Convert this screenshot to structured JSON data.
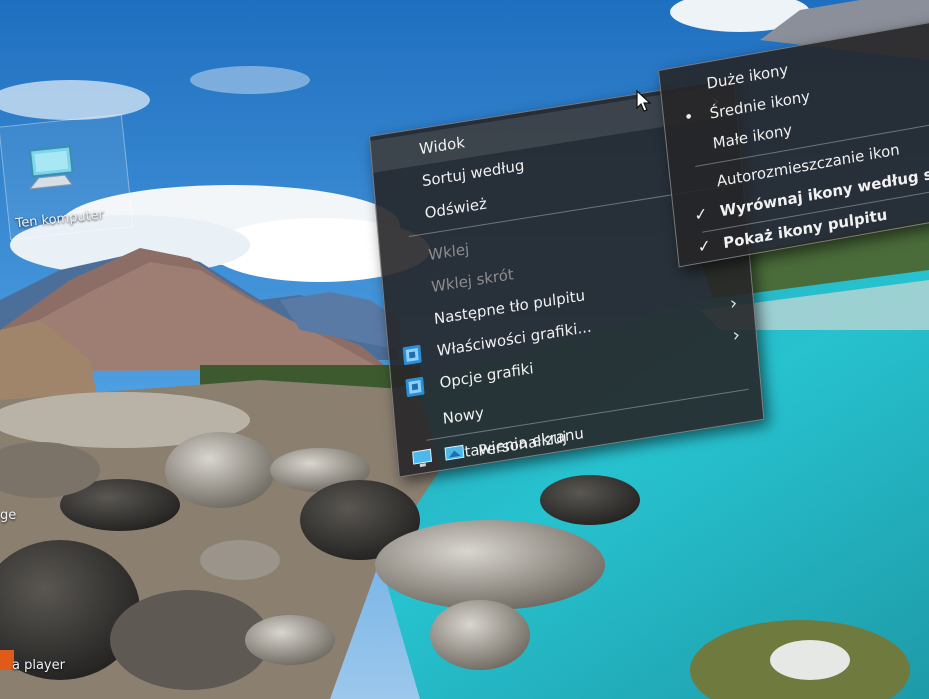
{
  "desktop": {
    "this_pc_label": "Ten komputer",
    "media_player_label": "a player",
    "edge_fragment_label": "ge"
  },
  "context_menu": {
    "items": [
      {
        "label": "Widok",
        "submenu": true,
        "enabled": true
      },
      {
        "label": "Sortuj według",
        "submenu": false,
        "enabled": true
      },
      {
        "label": "Odśwież",
        "submenu": false,
        "enabled": true
      },
      {
        "label": "Wklej",
        "submenu": false,
        "enabled": false
      },
      {
        "label": "Wklej skrót",
        "submenu": false,
        "enabled": false
      },
      {
        "label": "Następne tło pulpitu",
        "submenu": false,
        "enabled": true
      },
      {
        "label": "Właściwości grafiki...",
        "submenu": true,
        "enabled": true,
        "icon": "graphics-icon"
      },
      {
        "label": "Opcje grafiki",
        "submenu": true,
        "enabled": true,
        "icon": "graphics-icon"
      },
      {
        "label": "Nowy",
        "submenu": false,
        "enabled": true
      },
      {
        "label": "Ustawienia ekranu",
        "submenu": false,
        "enabled": true,
        "icon": "display-icon"
      },
      {
        "label": "Personalizuj",
        "submenu": false,
        "enabled": true,
        "icon": "personalize-icon"
      }
    ]
  },
  "view_submenu": {
    "items": [
      {
        "label": "Duże ikony",
        "mark": ""
      },
      {
        "label": "Średnie ikony",
        "mark": "•"
      },
      {
        "label": "Małe ikony",
        "mark": ""
      },
      {
        "label": "Autorozmieszczanie ikon",
        "mark": ""
      },
      {
        "label": "Wyrównaj ikony według si",
        "mark": "✓"
      },
      {
        "label": "Pokaż ikony pulpitu",
        "mark": "✓"
      }
    ]
  },
  "colors": {
    "menu_background": "#262628",
    "menu_text": "#f1f1f1",
    "disabled_text": "#8d8d90",
    "water_accent": "#1fb8c8"
  }
}
